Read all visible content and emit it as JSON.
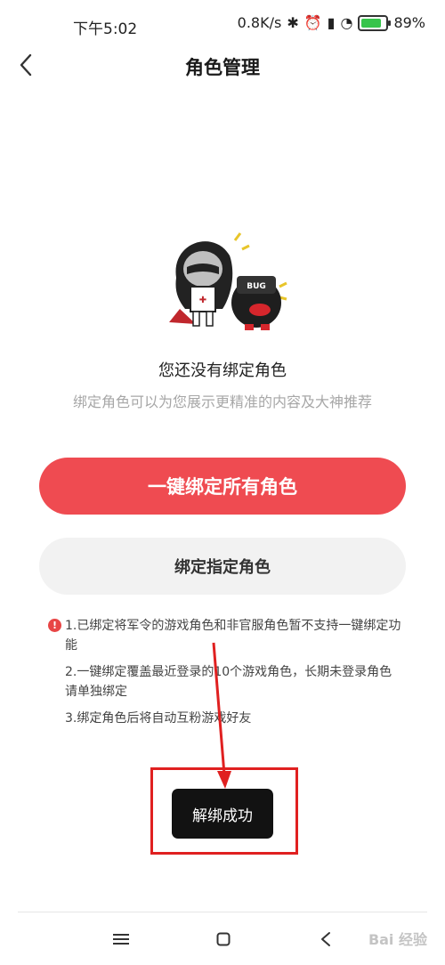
{
  "status_bar": {
    "time": "下午5:02",
    "speed": "0.8K/s",
    "battery": "89%"
  },
  "header": {
    "title": "角色管理"
  },
  "empty_state": {
    "title": "您还没有绑定角色",
    "subtitle": "绑定角色可以为您展示更精准的内容及大神推荐",
    "badge_text": "BUG"
  },
  "actions": {
    "bind_all_label": "一键绑定所有角色",
    "bind_specific_label": "绑定指定角色"
  },
  "notes": [
    "1.已绑定将军令的游戏角色和非官服角色暂不支持一键绑定功能",
    "2.一键绑定覆盖最近登录的10个游戏角色，长期未登录角色请单独绑定",
    "3.绑定角色后将自动互粉游戏好友"
  ],
  "toast": {
    "text": "解绑成功"
  },
  "watermark": "Bai 经验",
  "icons": {
    "back": "chevron-left-icon",
    "warning": "exclamation-circle-icon",
    "menu": "menu-icon",
    "home": "square-home-icon",
    "nav_back": "back-triangle-icon"
  },
  "colors": {
    "primary": "#ef4b51",
    "secondary_bg": "#f2f2f2",
    "annotation": "#e02020",
    "toast_bg": "#121212"
  }
}
